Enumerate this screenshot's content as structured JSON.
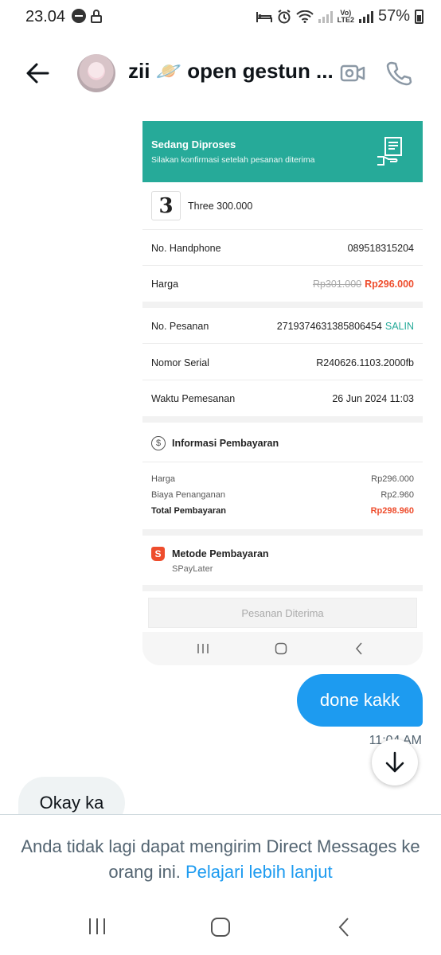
{
  "status_bar": {
    "time": "23.04",
    "battery": "57%",
    "network": "LTE2"
  },
  "header": {
    "title": "zii 🪐 open gestun ..."
  },
  "order_card": {
    "banner": {
      "title": "Sedang Diproses",
      "subtitle": "Silakan konfirmasi setelah pesanan diterima"
    },
    "product": {
      "logo_text": "3",
      "name": "Three 300.000"
    },
    "details": [
      {
        "label": "No. Handphone",
        "value": "089518315204"
      },
      {
        "label": "Harga",
        "original": "Rp301.000",
        "value": "Rp296.000"
      },
      {
        "label": "No. Pesanan",
        "value": "2719374631385806454",
        "action": "SALIN"
      },
      {
        "label": "Nomor Serial",
        "value": "R240626.1103.2000fb"
      },
      {
        "label": "Waktu Pemesanan",
        "value": "26 Jun 2024 11:03"
      }
    ],
    "payment_info": {
      "title": "Informasi Pembayaran",
      "rows": [
        {
          "label": "Harga",
          "value": "Rp296.000"
        },
        {
          "label": "Biaya Penanganan",
          "value": "Rp2.960"
        },
        {
          "label": "Total Pembayaran",
          "value": "Rp298.960"
        }
      ]
    },
    "payment_method": {
      "title": "Metode Pembayaran",
      "value": "SPayLater"
    },
    "button": "Pesanan Diterima"
  },
  "messages": [
    {
      "direction": "outgoing",
      "text": "done kakk",
      "time": "11:04 AM"
    },
    {
      "direction": "incoming",
      "text": "Okay ka"
    }
  ],
  "footer": {
    "notice": "Anda tidak lagi dapat mengirim Direct Messages ke orang ini.",
    "link": "Pelajari lebih lanjut"
  },
  "colors": {
    "twitter_blue": "#1d9bf0",
    "shopee_teal": "#26aa99",
    "shopee_orange": "#ee4d2d"
  }
}
